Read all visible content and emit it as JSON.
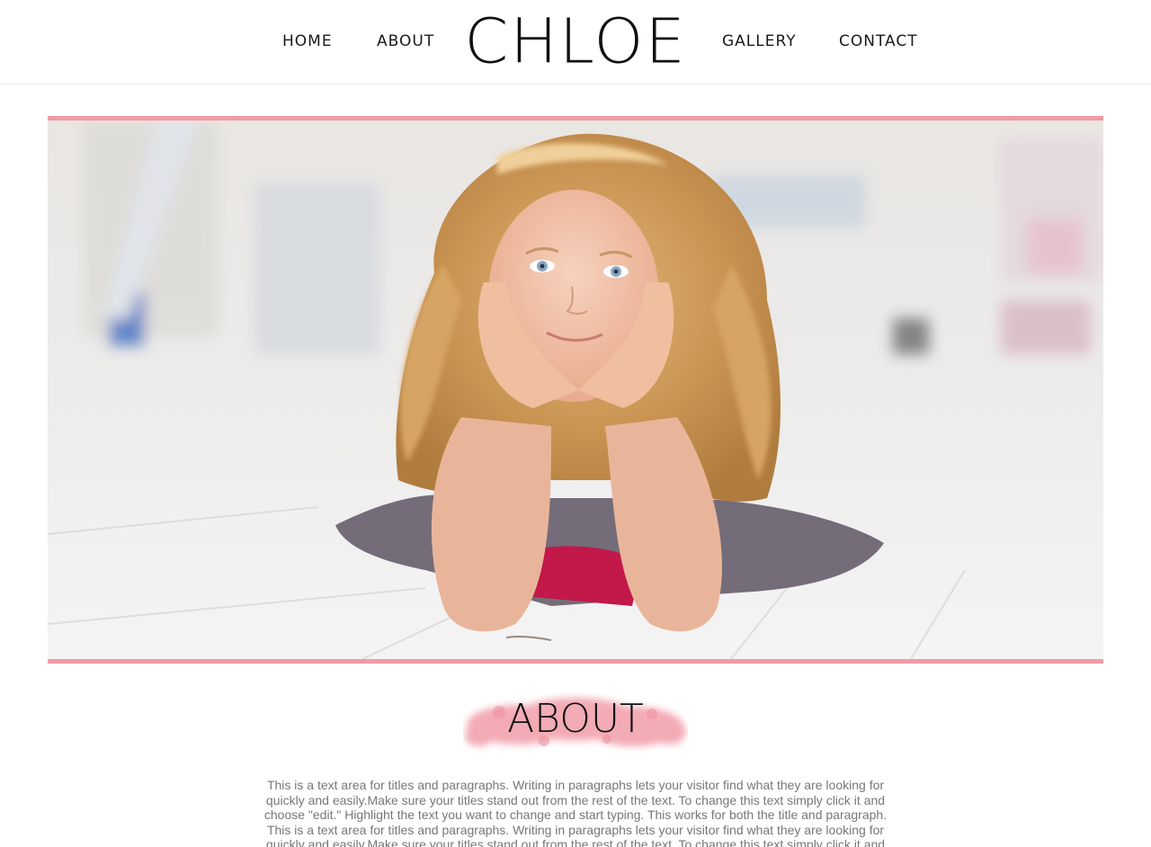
{
  "header": {
    "logo_text": "CHLOE",
    "nav": {
      "home": "HOME",
      "about": "ABOUT",
      "gallery": "GALLERY",
      "contact": "CONTACT"
    }
  },
  "about": {
    "title": "ABOUT",
    "paragraph": "This is a text area for titles and paragraphs. Writing in paragraphs lets your visitor find what they are looking for quickly and easily.Make sure your titles stand out from the rest of the text. To change this text simply click it and choose \"edit.\" Highlight the text you want to change and start typing. This works for both the title and paragraph. This is a text area for titles and paragraphs. Writing in paragraphs lets your visitor find what they are looking for quickly and easily.Make sure your titles stand out from the rest of the text. To change this text simply click it and choose \"edit.\" Highlight the text you want to change and start typing. This works for both the title and paragraph."
  },
  "colors": {
    "accent_pink": "#f29aa4",
    "text_dark": "#1a1a1a",
    "text_muted": "#777777"
  }
}
